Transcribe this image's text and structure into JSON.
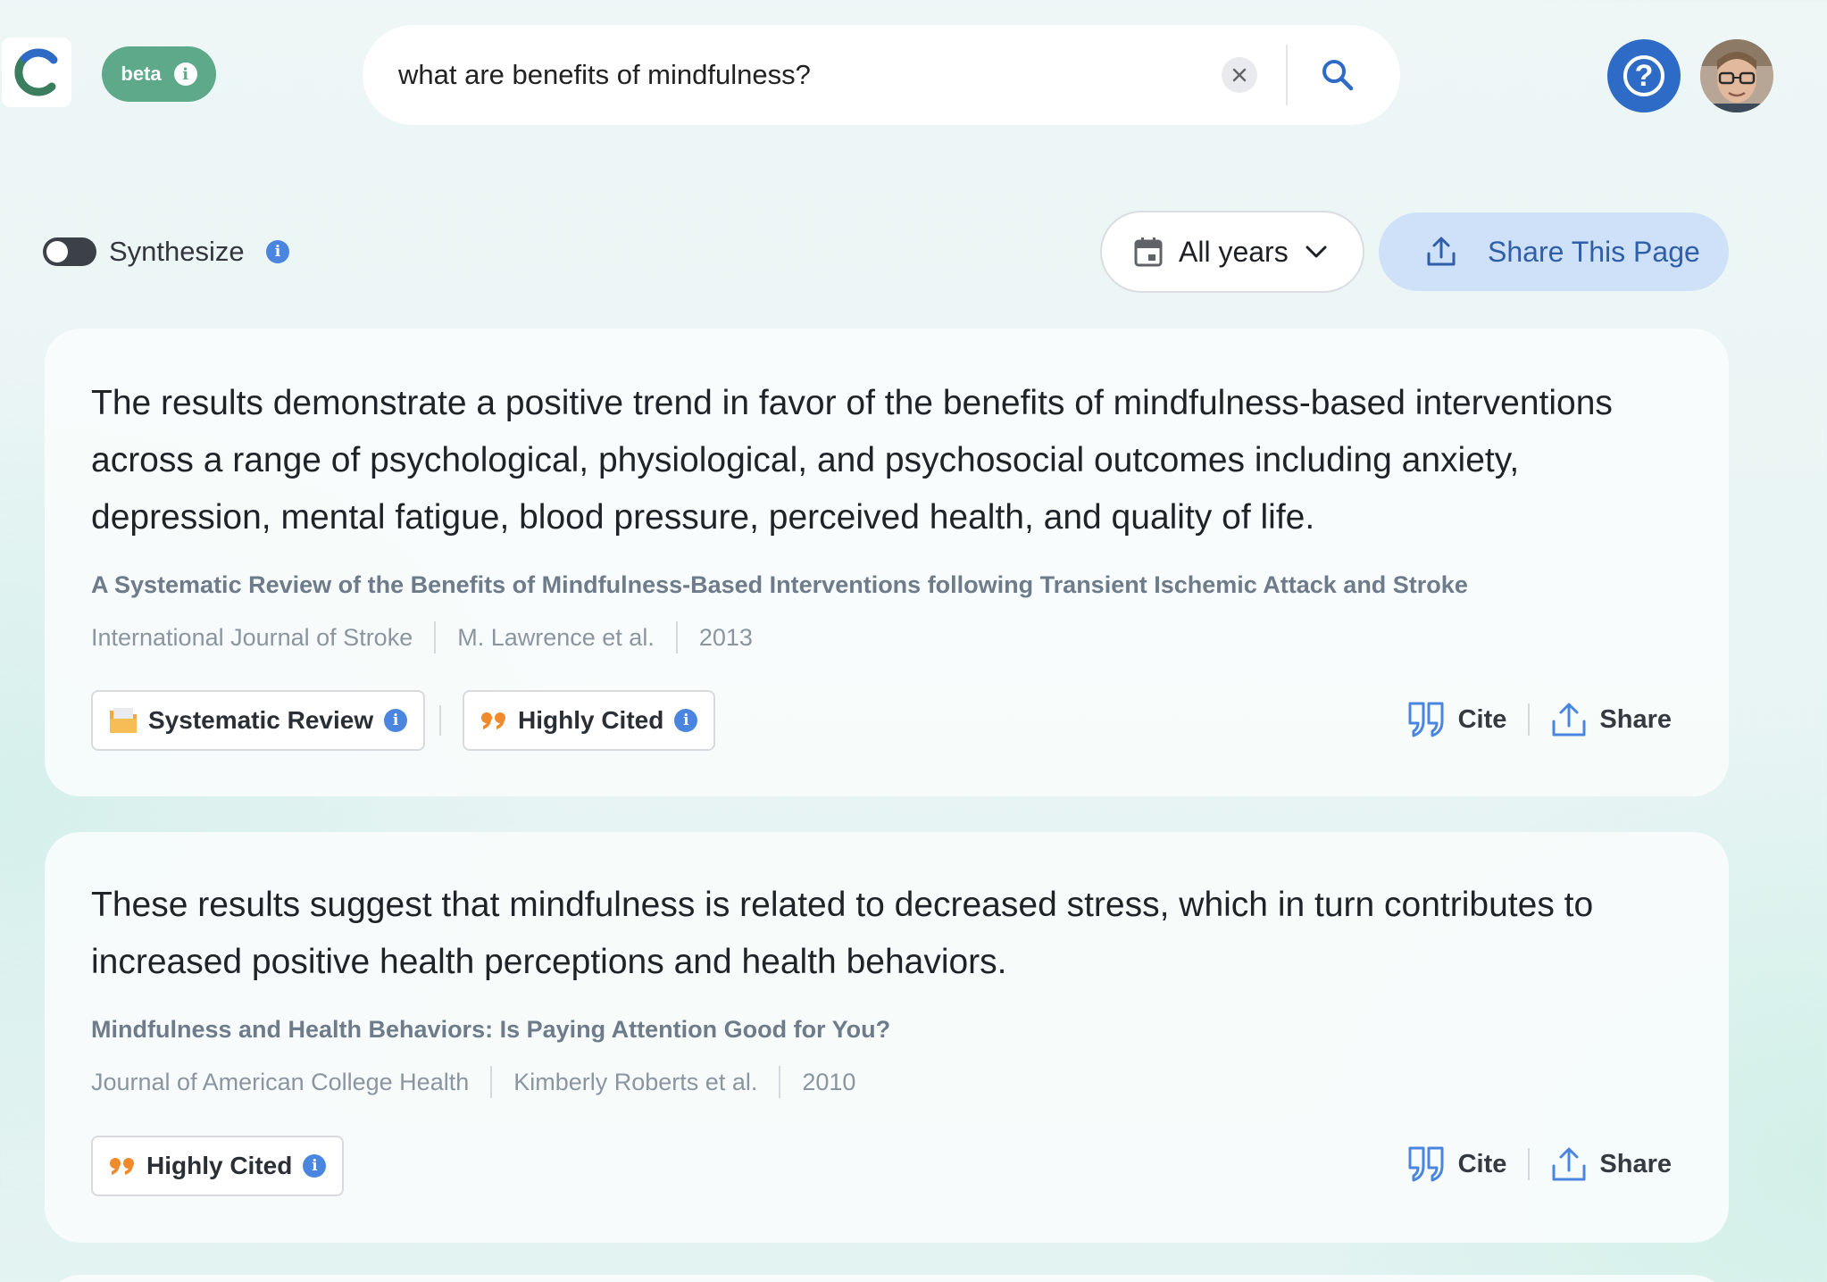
{
  "header": {
    "logo_icon": "consensus-logo-icon",
    "beta_label": "beta",
    "search": {
      "value": "what are benefits of mindfulness?",
      "clear_icon": "close-icon",
      "search_icon": "search-icon"
    },
    "help_icon": "question-mark-icon",
    "avatar_icon": "user-avatar"
  },
  "toolbar": {
    "synthesize_label": "Synthesize",
    "synthesize_on": false,
    "years_label": "All years",
    "share_page_label": "Share This Page"
  },
  "results": [
    {
      "claim": "The results demonstrate a positive trend in favor of the benefits of mindfulness-based interventions across a range of psychological, physiological, and psychosocial outcomes including anxiety, depression, mental fatigue, blood pressure, perceived health, and quality of life.",
      "title": "A Systematic Review of the Benefits of Mindfulness-Based Interventions following Transient Ischemic Attack and Stroke",
      "journal": "International Journal of Stroke",
      "authors": "M. Lawrence et al.",
      "year": "2013",
      "badges": [
        "Systematic Review",
        "Highly Cited"
      ],
      "cite_label": "Cite",
      "share_label": "Share"
    },
    {
      "claim": "These results suggest that mindfulness is related to decreased stress, which in turn contributes to increased positive health perceptions and health behaviors.",
      "title": "Mindfulness and Health Behaviors: Is Paying Attention Good for You?",
      "journal": "Journal of American College Health",
      "authors": "Kimberly Roberts et al.",
      "year": "2010",
      "badges": [
        "Highly Cited"
      ],
      "cite_label": "Cite",
      "share_label": "Share"
    }
  ],
  "colors": {
    "accent_blue": "#2d6bc6",
    "beta_green": "#5ea98a",
    "share_bg": "#cfe1f8",
    "cited_orange": "#f08a2c"
  }
}
